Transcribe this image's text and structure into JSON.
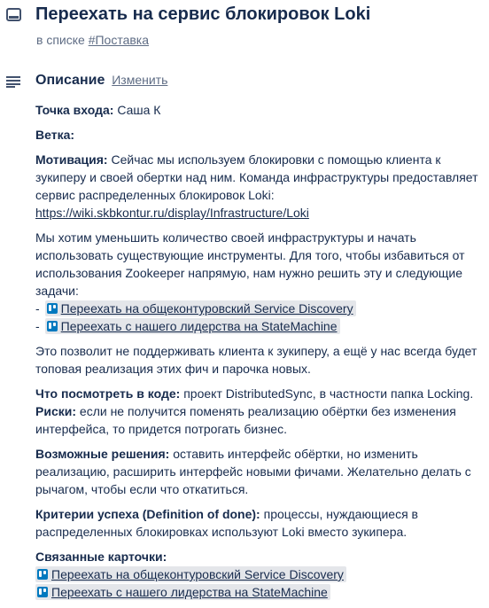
{
  "card": {
    "icon": "card-icon",
    "title": "Переехать на сервис блокировок Loki",
    "in_list_prefix": "в списке",
    "list_link": "#Поставка"
  },
  "description": {
    "icon": "description-icon",
    "heading": "Описание",
    "edit_label": "Изменить",
    "entry_label": "Точка входа:",
    "entry_value": "Саша К",
    "branch_label": "Ветка:",
    "motivation_label": "Мотивация:",
    "motivation_text": "Сейчас мы используем блокировки с помощью клиента к зукиперу и своей обертки над ним. Команда инфраструктуры предоставляет сервис распределенных блокировок Loki:",
    "motivation_link": "https://wiki.skbkontur.ru/display/Infrastructure/Loki",
    "goal_text": "Мы хотим уменьшить количество своей инфраструктуры и начать использовать существующие инструменты. Для того, чтобы избавиться от использования Zookeeper напрямую, нам нужно решить эту и следующие задачи:",
    "tasks": [
      {
        "dash": "-",
        "label": "Переехать на общеконтуровский Service Discovery"
      },
      {
        "dash": "-",
        "label": "Переехать с нашего лидерства на StateMachine"
      }
    ],
    "benefit_text": "Это позволит не поддерживать клиента к зукиперу, а ещё у нас всегда будет топовая реализация этих фич и парочка новых.",
    "code_label": "Что посмотреть в коде:",
    "code_text": "проект DistributedSync, в частности папка Locking.",
    "risks_label": "Риски:",
    "risks_text": "если не получится поменять реализацию обёртки без изменения интерфейса, то придется потрогать бизнес.",
    "solutions_label": "Возможные решения:",
    "solutions_text": "оставить интерфейс обёртки, но изменить реализацию, расширить интерфейс новыми фичами. Желательно делать с рычагом, чтобы если что откатиться.",
    "done_label": "Критерии успеха (Definition of done):",
    "done_text": "процессы, нуждающиеся в распределенных блокировках используют Loki вместо зукипера.",
    "related_label": "Связанные карточки:",
    "related": [
      {
        "label": "Переехать на общеконтуровский Service Discovery"
      },
      {
        "label": "Переехать с нашего лидерства на StateMachine"
      }
    ]
  }
}
